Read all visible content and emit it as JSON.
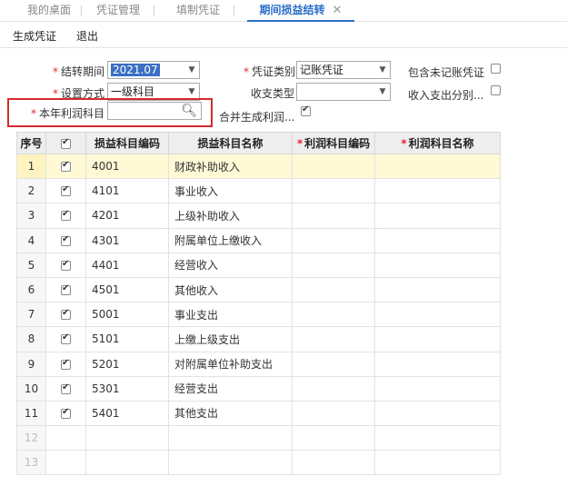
{
  "tabs": [
    {
      "label": "我的桌面",
      "active": false
    },
    {
      "label": "凭证管理",
      "active": false
    },
    {
      "label": "填制凭证",
      "active": false
    },
    {
      "label": "期间损益结转",
      "active": true
    }
  ],
  "toolbar": {
    "generate_label": "生成凭证",
    "exit_label": "退出"
  },
  "form": {
    "period_label": "结转期间",
    "period_value": "2021.07",
    "voucher_type_label": "凭证类别",
    "voucher_type_value": "记账凭证",
    "include_unposted_label": "包含未记账凭证",
    "setting_label": "设置方式",
    "setting_value": "一级科目",
    "income_type_label": "收支类型",
    "income_type_value": "",
    "income_split_label": "收入支出分别...",
    "profit_account_label": "本年利润科目",
    "profit_account_value": "",
    "merge_label": "合并生成利润..."
  },
  "table": {
    "headers": {
      "no": "序号",
      "code": "损益科目编码",
      "name": "损益科目名称",
      "profit_code": "利润科目编码",
      "profit_name": "利润科目名称"
    },
    "rows": [
      {
        "no": "1",
        "code": "4001",
        "name": "财政补助收入"
      },
      {
        "no": "2",
        "code": "4101",
        "name": "事业收入"
      },
      {
        "no": "3",
        "code": "4201",
        "name": "上级补助收入"
      },
      {
        "no": "4",
        "code": "4301",
        "name": "附属单位上缴收入"
      },
      {
        "no": "5",
        "code": "4401",
        "name": "经营收入"
      },
      {
        "no": "6",
        "code": "4501",
        "name": "其他收入"
      },
      {
        "no": "7",
        "code": "5001",
        "name": "事业支出"
      },
      {
        "no": "8",
        "code": "5101",
        "name": "上缴上级支出"
      },
      {
        "no": "9",
        "code": "5201",
        "name": "对附属单位补助支出"
      },
      {
        "no": "10",
        "code": "5301",
        "name": "经营支出"
      },
      {
        "no": "11",
        "code": "5401",
        "name": "其他支出"
      }
    ],
    "empty_rows": [
      "12",
      "13"
    ]
  }
}
